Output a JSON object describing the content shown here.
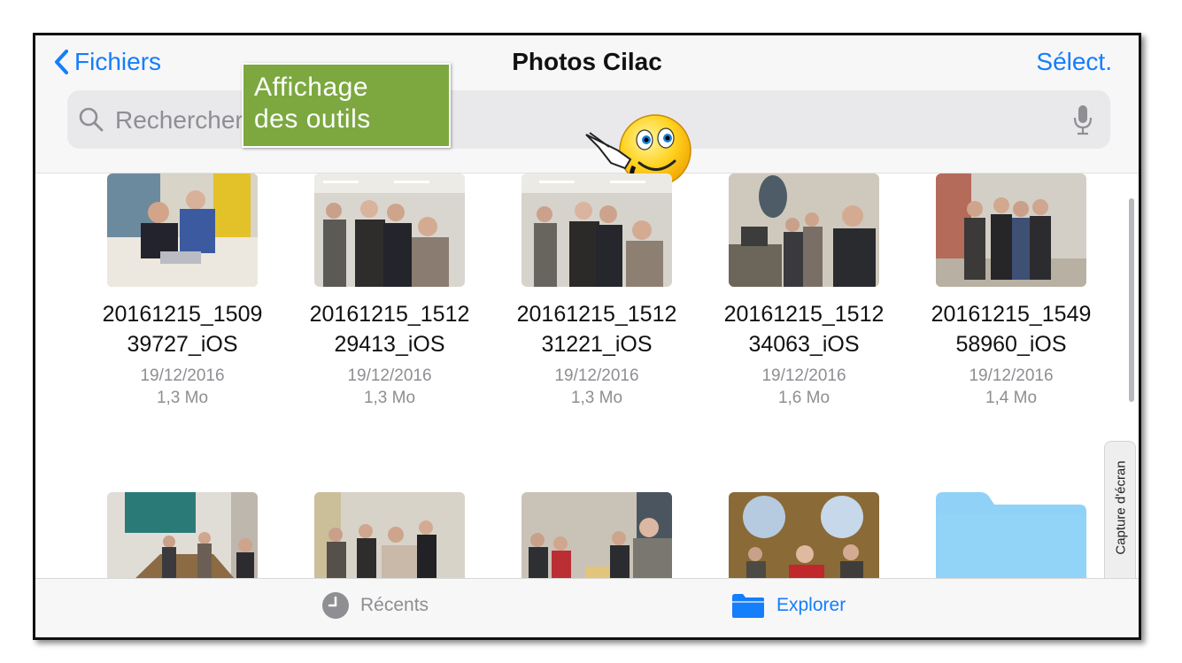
{
  "navbar": {
    "back_label": "Fichiers",
    "title": "Photos Cilac",
    "select_label": "Sélect."
  },
  "search": {
    "placeholder": "Rechercher"
  },
  "callout": {
    "line1": "Affichage",
    "line2": "des outils"
  },
  "files": [
    {
      "name_line1": "20161215_1509",
      "name_line2": "39727_iOS",
      "date": "19/12/2016",
      "size": "1,3 Mo"
    },
    {
      "name_line1": "20161215_1512",
      "name_line2": "29413_iOS",
      "date": "19/12/2016",
      "size": "1,3 Mo"
    },
    {
      "name_line1": "20161215_1512",
      "name_line2": "31221_iOS",
      "date": "19/12/2016",
      "size": "1,3 Mo"
    },
    {
      "name_line1": "20161215_1512",
      "name_line2": "34063_iOS",
      "date": "19/12/2016",
      "size": "1,6 Mo"
    },
    {
      "name_line1": "20161215_1549",
      "name_line2": "58960_iOS",
      "date": "19/12/2016",
      "size": "1,4 Mo"
    }
  ],
  "side_tab": {
    "label": "Capture d'écran"
  },
  "tabbar": {
    "recents_label": "Récents",
    "explorer_label": "Explorer"
  },
  "colors": {
    "accent": "#147efb",
    "callout": "#7ca83f",
    "folder": "#8fd1f7"
  }
}
